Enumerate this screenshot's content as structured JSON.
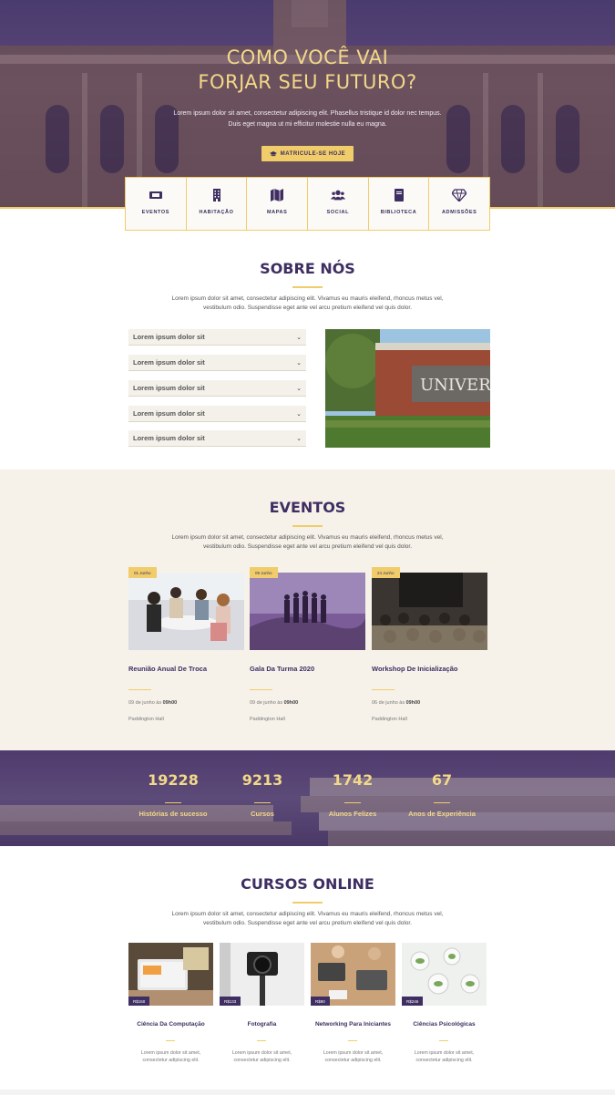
{
  "hero": {
    "title_line1": "COMO VOCÊ VAI",
    "title_line2": "FORJAR SEU FUTURO?",
    "text": "Lorem ipsum dolor sit amet, consectetur adipiscing elit. Phasellus tristique id dolor nec tempus. Duis eget magna ut mi efficitur molestie nulla eu magna.",
    "button": "MATRICULE-SE HOJE",
    "button_icon": "graduation-cap-icon"
  },
  "features": [
    {
      "label": "EVENTOS",
      "icon": "ticket-icon"
    },
    {
      "label": "HABITAÇÃO",
      "icon": "building-icon"
    },
    {
      "label": "MAPAS",
      "icon": "map-icon"
    },
    {
      "label": "SOCIAL",
      "icon": "users-icon"
    },
    {
      "label": "BIBLIOTECA",
      "icon": "book-icon"
    },
    {
      "label": "ADMISSÕES",
      "icon": "diamond-icon"
    }
  ],
  "about": {
    "title": "SOBRE NÓS",
    "text": "Lorem ipsum dolor sit amet, consectetur adipiscing elit. Vivamus eu mauris eleifend, rhoncus metus vel, vestibulum odio. Suspendisse eget ante vel arcu pretium eleifend vel quis dolor.",
    "accordion": [
      "Lorem ipsum dolor sit",
      "Lorem ipsum dolor sit",
      "Lorem ipsum dolor sit",
      "Lorem ipsum dolor sit",
      "Lorem ipsum dolor sit"
    ],
    "image_sign": "UNIVERSIT"
  },
  "events": {
    "title": "EVENTOS",
    "text": "Lorem ipsum dolor sit amet, consectetur adipiscing elit. Vivamus eu mauris eleifend, rhoncus metus vel, vestibulum odio. Suspendisse eget ante vel arcu pretium eleifend vel quis dolor.",
    "items": [
      {
        "date": "01 Junho",
        "title": "Reunião Anual De Troca",
        "time_prefix": "09 de junho às",
        "time": "09h00",
        "place": "Paddington Hall"
      },
      {
        "date": "09 Junho",
        "title": "Gala Da Turma 2020",
        "time_prefix": "09 de junho às",
        "time": "09h00",
        "place": "Paddington Hall"
      },
      {
        "date": "24 Junho",
        "title": "Workshop De Inicialização",
        "time_prefix": "06 de junho às",
        "time": "09h00",
        "place": "Paddington Hall"
      }
    ]
  },
  "stats": [
    {
      "number": "19228",
      "label": "Histórias de sucesso"
    },
    {
      "number": "9213",
      "label": "Cursos"
    },
    {
      "number": "1742",
      "label": "Alunos Felizes"
    },
    {
      "number": "67",
      "label": "Anos de Experiência"
    }
  ],
  "courses": {
    "title": "CURSOS ONLINE",
    "text": "Lorem ipsum dolor sit amet, consectetur adipiscing elit. Vivamus eu mauris eleifend, rhoncus metus vel, vestibulum odio. Suspendisse eget ante vel arcu pretium eleifend vel quis dolor.",
    "items": [
      {
        "price": "R$150",
        "title": "Ciência Da Computação",
        "text": "Lorem ipsum dolor sit amet, consectetur adipiscing elit."
      },
      {
        "price": "R$133",
        "title": "Fotografia",
        "text": "Lorem ipsum dolor sit amet, consectetur adipiscing elit."
      },
      {
        "price": "R$90",
        "title": "Networking Para Iniciantes",
        "text": "Lorem ipsum dolor sit amet, consectetur adipiscing elit."
      },
      {
        "price": "R$246",
        "title": "Ciências Psicológicas",
        "text": "Lorem ipsum dolor sit amet, consectetur adipiscing elit."
      }
    ]
  },
  "colors": {
    "purple": "#3e2e62",
    "gold": "#f0cc6a",
    "cream": "#f6f2ea"
  }
}
